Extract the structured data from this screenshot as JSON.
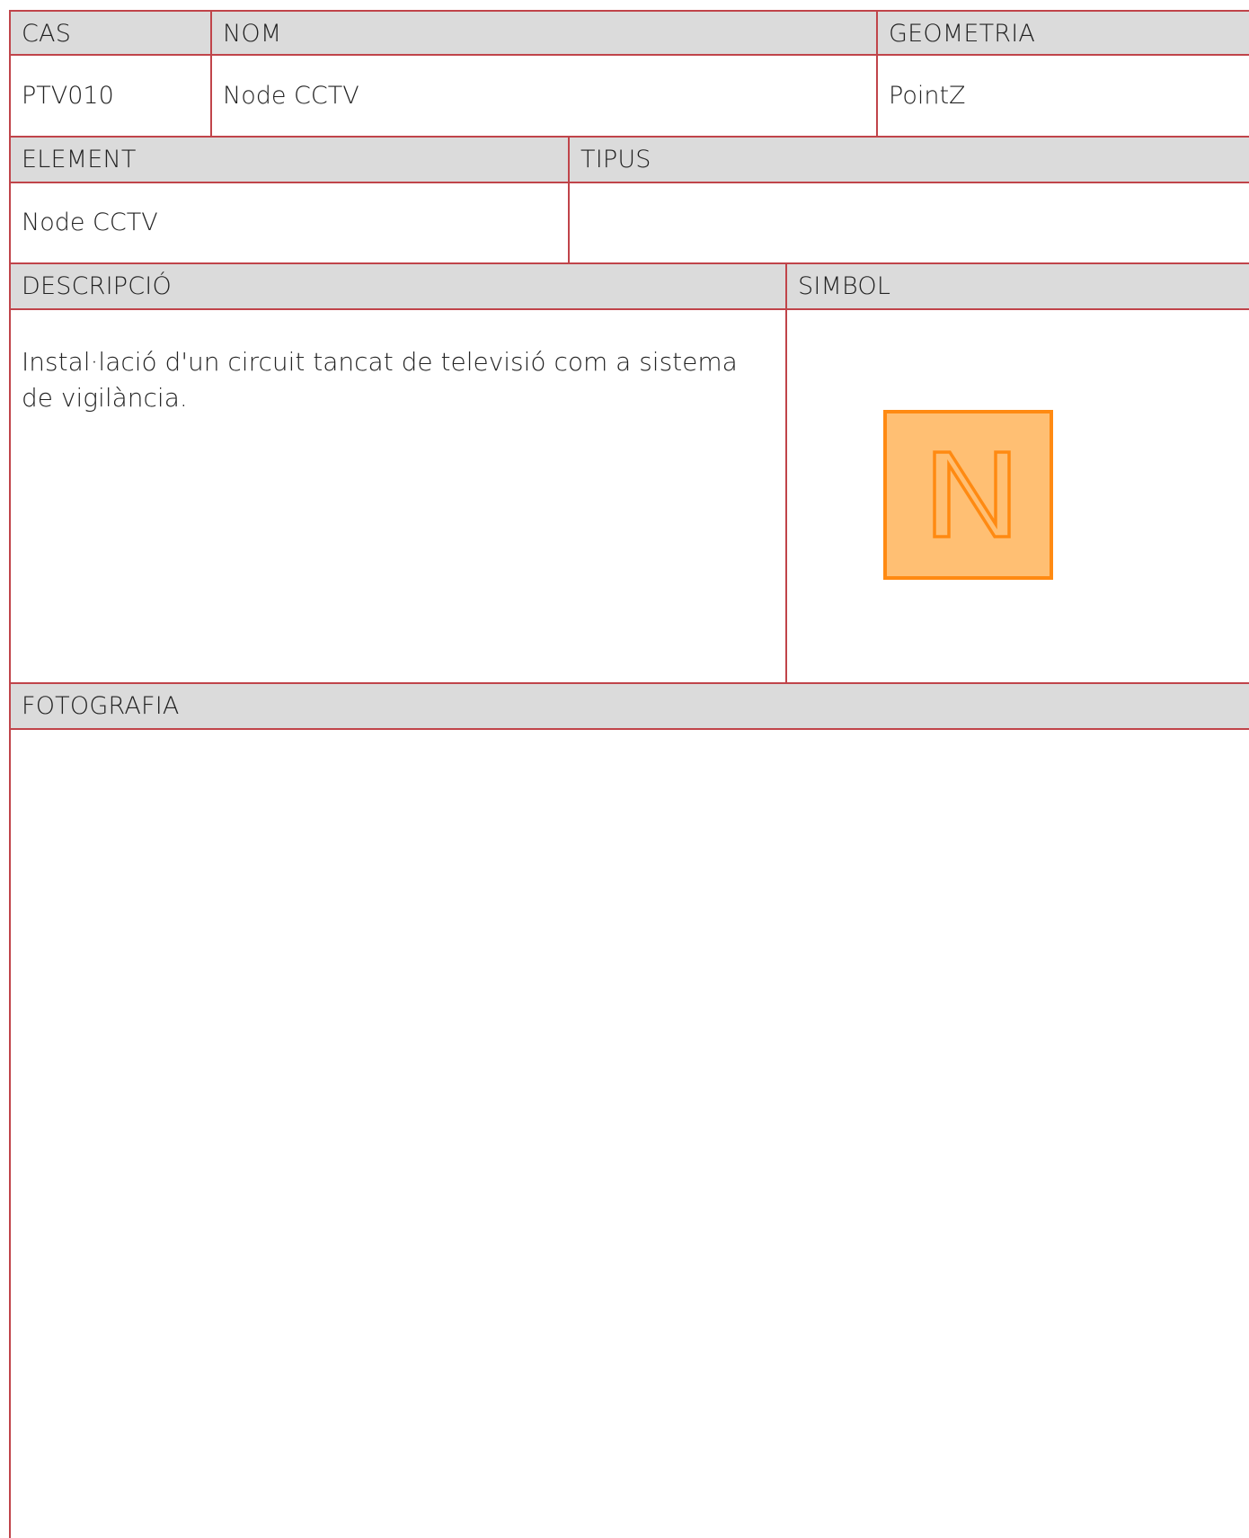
{
  "row1": {
    "headers": {
      "cas": "CAS",
      "nom": "NOM",
      "geometria": "GEOMETRIA"
    },
    "values": {
      "cas": "PTV010",
      "nom": "Node CCTV",
      "geometria": "PointZ"
    }
  },
  "row2": {
    "headers": {
      "element": "ELEMENT",
      "tipus": "TIPUS"
    },
    "values": {
      "element": "Node CCTV",
      "tipus": ""
    }
  },
  "row3": {
    "headers": {
      "descripcio": "DESCRIPCIÓ",
      "simbol": "SIMBOL"
    },
    "values": {
      "descripcio": "Instal·lació d'un circuit tancat de televisió com a sistema de vigilància.",
      "simbol": {
        "letter": "N",
        "icon": "node-n-square-icon",
        "fill_color": "#ffbf73",
        "stroke_color": "#ff8a12"
      }
    }
  },
  "row4": {
    "headers": {
      "fotografia": "FOTOGRAFIA"
    }
  },
  "colors": {
    "border": "#c0444a",
    "header_background": "#dbdbdb"
  }
}
